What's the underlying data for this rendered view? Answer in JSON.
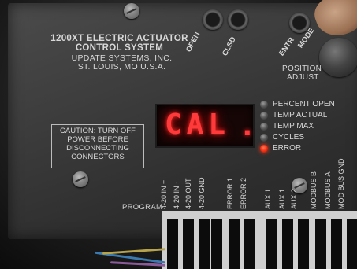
{
  "panel": {
    "title_line1": "1200XT ELECTRIC ACTUATOR",
    "title_line2": "CONTROL SYSTEM",
    "maker": "UPDATE SYSTEMS, INC.",
    "location": "ST. LOUIS, MO U.S.A."
  },
  "buttons": {
    "open": "OPEN",
    "clsd": "CLSD",
    "entr": "ENTR",
    "mode": "MODE",
    "position_adjust_line1": "POSITION",
    "position_adjust_line2": "ADJUST"
  },
  "caution": {
    "line1": "CAUTION: TURN OFF",
    "line2": "POWER BEFORE",
    "line3": "DISCONNECTING",
    "line4": "CONNECTORS"
  },
  "display": {
    "text": "CAL",
    "dot": "."
  },
  "indicators": [
    {
      "label": "PERCENT OPEN",
      "on": false
    },
    {
      "label": "TEMP ACTUAL",
      "on": false
    },
    {
      "label": "TEMP MAX",
      "on": false
    },
    {
      "label": "CYCLES",
      "on": false
    },
    {
      "label": "ERROR",
      "on": true
    }
  ],
  "terminals": {
    "program": "PROGRAM",
    "labels": [
      "4-20 IN +",
      "4-20 IN -",
      "4-20 OUT",
      "4-20 GND",
      "ERROR 1",
      "ERROR 2",
      "AUX 1",
      "AUX 1",
      "AUX 2",
      "MODBUS B",
      "MODBUS A",
      "MOD BUS GND"
    ]
  },
  "colors": {
    "led": "#ff3a3a",
    "panel": "#3d3d3d",
    "silkscreen": "#d8d8d8"
  }
}
